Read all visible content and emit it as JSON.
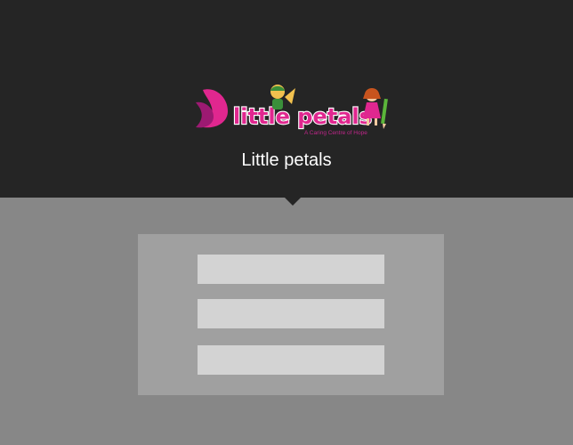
{
  "header": {
    "logo": {
      "wordmark": "little petals",
      "tagline": "A Caring Centre of Hope",
      "brand_color": "#e0278f",
      "icons": [
        "butterfly-icon",
        "kite-kid-icon",
        "girl-with-pencil-icon"
      ]
    },
    "brand_name": "Little petals"
  },
  "form": {
    "fields": [
      {
        "value": "",
        "placeholder": ""
      },
      {
        "value": "",
        "placeholder": ""
      },
      {
        "value": "",
        "placeholder": ""
      }
    ]
  },
  "colors": {
    "header_bg": "#252525",
    "page_bg": "#878787",
    "card_bg": "#a0a0a0",
    "field_bg": "#d3d3d3"
  }
}
